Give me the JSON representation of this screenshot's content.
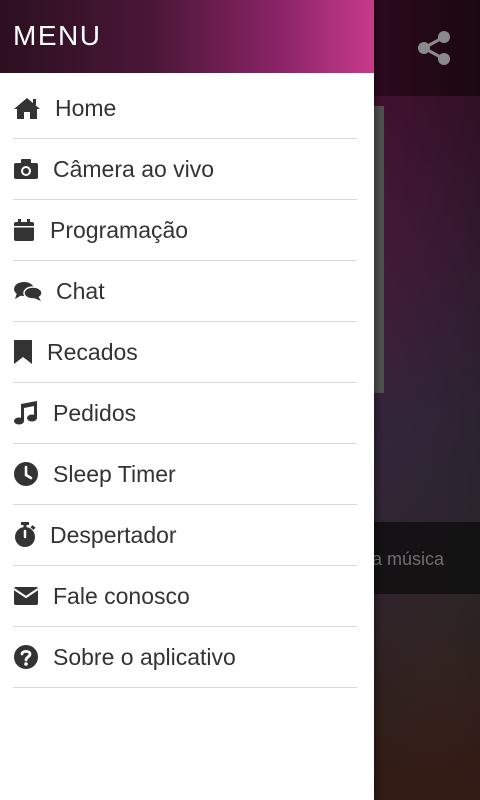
{
  "drawer": {
    "title": "MENU",
    "items": [
      {
        "label": "Home",
        "icon": "home-icon"
      },
      {
        "label": "Câmera ao vivo",
        "icon": "camera-icon"
      },
      {
        "label": "Programação",
        "icon": "calendar-icon"
      },
      {
        "label": "Chat",
        "icon": "chat-bubbles-icon"
      },
      {
        "label": "Recados",
        "icon": "bookmark-icon"
      },
      {
        "label": "Pedidos",
        "icon": "music-note-icon"
      },
      {
        "label": "Sleep Timer",
        "icon": "clock-icon"
      },
      {
        "label": "Despertador",
        "icon": "stopwatch-icon"
      },
      {
        "label": "Fale conosco",
        "icon": "envelope-icon"
      },
      {
        "label": "Sobre o aplicativo",
        "icon": "question-circle-icon"
      }
    ]
  },
  "background": {
    "now_playing_partial": "a música",
    "icons": [
      "share-icon"
    ]
  },
  "colors": {
    "drawer_bg": "#ffffff",
    "header_gradient_end": "#c73a8a",
    "text": "#333333",
    "divider": "#d9d9d9"
  }
}
